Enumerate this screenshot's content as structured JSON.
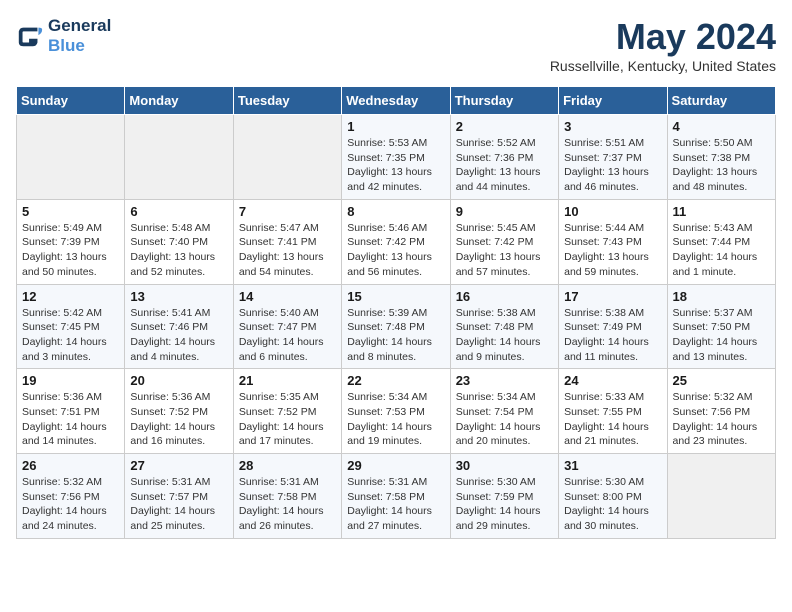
{
  "header": {
    "logo_line1": "General",
    "logo_line2": "Blue",
    "month": "May 2024",
    "location": "Russellville, Kentucky, United States"
  },
  "weekdays": [
    "Sunday",
    "Monday",
    "Tuesday",
    "Wednesday",
    "Thursday",
    "Friday",
    "Saturday"
  ],
  "weeks": [
    [
      {
        "day": "",
        "info": ""
      },
      {
        "day": "",
        "info": ""
      },
      {
        "day": "",
        "info": ""
      },
      {
        "day": "1",
        "info": "Sunrise: 5:53 AM\nSunset: 7:35 PM\nDaylight: 13 hours\nand 42 minutes."
      },
      {
        "day": "2",
        "info": "Sunrise: 5:52 AM\nSunset: 7:36 PM\nDaylight: 13 hours\nand 44 minutes."
      },
      {
        "day": "3",
        "info": "Sunrise: 5:51 AM\nSunset: 7:37 PM\nDaylight: 13 hours\nand 46 minutes."
      },
      {
        "day": "4",
        "info": "Sunrise: 5:50 AM\nSunset: 7:38 PM\nDaylight: 13 hours\nand 48 minutes."
      }
    ],
    [
      {
        "day": "5",
        "info": "Sunrise: 5:49 AM\nSunset: 7:39 PM\nDaylight: 13 hours\nand 50 minutes."
      },
      {
        "day": "6",
        "info": "Sunrise: 5:48 AM\nSunset: 7:40 PM\nDaylight: 13 hours\nand 52 minutes."
      },
      {
        "day": "7",
        "info": "Sunrise: 5:47 AM\nSunset: 7:41 PM\nDaylight: 13 hours\nand 54 minutes."
      },
      {
        "day": "8",
        "info": "Sunrise: 5:46 AM\nSunset: 7:42 PM\nDaylight: 13 hours\nand 56 minutes."
      },
      {
        "day": "9",
        "info": "Sunrise: 5:45 AM\nSunset: 7:42 PM\nDaylight: 13 hours\nand 57 minutes."
      },
      {
        "day": "10",
        "info": "Sunrise: 5:44 AM\nSunset: 7:43 PM\nDaylight: 13 hours\nand 59 minutes."
      },
      {
        "day": "11",
        "info": "Sunrise: 5:43 AM\nSunset: 7:44 PM\nDaylight: 14 hours\nand 1 minute."
      }
    ],
    [
      {
        "day": "12",
        "info": "Sunrise: 5:42 AM\nSunset: 7:45 PM\nDaylight: 14 hours\nand 3 minutes."
      },
      {
        "day": "13",
        "info": "Sunrise: 5:41 AM\nSunset: 7:46 PM\nDaylight: 14 hours\nand 4 minutes."
      },
      {
        "day": "14",
        "info": "Sunrise: 5:40 AM\nSunset: 7:47 PM\nDaylight: 14 hours\nand 6 minutes."
      },
      {
        "day": "15",
        "info": "Sunrise: 5:39 AM\nSunset: 7:48 PM\nDaylight: 14 hours\nand 8 minutes."
      },
      {
        "day": "16",
        "info": "Sunrise: 5:38 AM\nSunset: 7:48 PM\nDaylight: 14 hours\nand 9 minutes."
      },
      {
        "day": "17",
        "info": "Sunrise: 5:38 AM\nSunset: 7:49 PM\nDaylight: 14 hours\nand 11 minutes."
      },
      {
        "day": "18",
        "info": "Sunrise: 5:37 AM\nSunset: 7:50 PM\nDaylight: 14 hours\nand 13 minutes."
      }
    ],
    [
      {
        "day": "19",
        "info": "Sunrise: 5:36 AM\nSunset: 7:51 PM\nDaylight: 14 hours\nand 14 minutes."
      },
      {
        "day": "20",
        "info": "Sunrise: 5:36 AM\nSunset: 7:52 PM\nDaylight: 14 hours\nand 16 minutes."
      },
      {
        "day": "21",
        "info": "Sunrise: 5:35 AM\nSunset: 7:52 PM\nDaylight: 14 hours\nand 17 minutes."
      },
      {
        "day": "22",
        "info": "Sunrise: 5:34 AM\nSunset: 7:53 PM\nDaylight: 14 hours\nand 19 minutes."
      },
      {
        "day": "23",
        "info": "Sunrise: 5:34 AM\nSunset: 7:54 PM\nDaylight: 14 hours\nand 20 minutes."
      },
      {
        "day": "24",
        "info": "Sunrise: 5:33 AM\nSunset: 7:55 PM\nDaylight: 14 hours\nand 21 minutes."
      },
      {
        "day": "25",
        "info": "Sunrise: 5:32 AM\nSunset: 7:56 PM\nDaylight: 14 hours\nand 23 minutes."
      }
    ],
    [
      {
        "day": "26",
        "info": "Sunrise: 5:32 AM\nSunset: 7:56 PM\nDaylight: 14 hours\nand 24 minutes."
      },
      {
        "day": "27",
        "info": "Sunrise: 5:31 AM\nSunset: 7:57 PM\nDaylight: 14 hours\nand 25 minutes."
      },
      {
        "day": "28",
        "info": "Sunrise: 5:31 AM\nSunset: 7:58 PM\nDaylight: 14 hours\nand 26 minutes."
      },
      {
        "day": "29",
        "info": "Sunrise: 5:31 AM\nSunset: 7:58 PM\nDaylight: 14 hours\nand 27 minutes."
      },
      {
        "day": "30",
        "info": "Sunrise: 5:30 AM\nSunset: 7:59 PM\nDaylight: 14 hours\nand 29 minutes."
      },
      {
        "day": "31",
        "info": "Sunrise: 5:30 AM\nSunset: 8:00 PM\nDaylight: 14 hours\nand 30 minutes."
      },
      {
        "day": "",
        "info": ""
      }
    ]
  ]
}
